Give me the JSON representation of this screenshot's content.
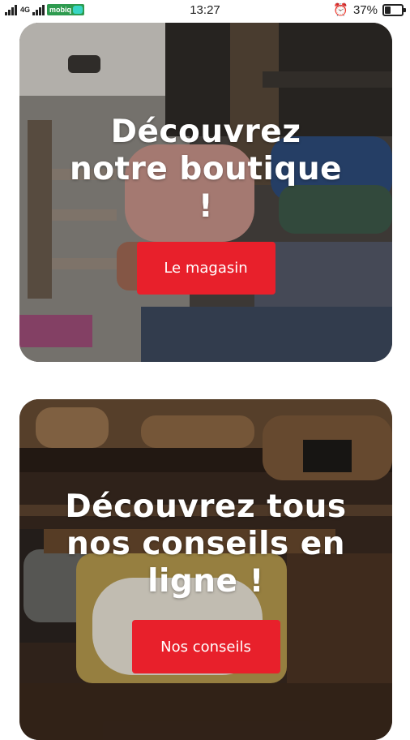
{
  "status_bar": {
    "network": "4G",
    "carrier": "mobiq",
    "time": "13:27",
    "battery": "37%",
    "battery_level": 0.37
  },
  "cards": [
    {
      "headline": "Découvrez notre boutique !",
      "button_label": "Le magasin"
    },
    {
      "headline": "Découvrez tous nos conseils en ligne !",
      "button_label": "Nos conseils"
    }
  ],
  "colors": {
    "cta": "#e8202b"
  }
}
